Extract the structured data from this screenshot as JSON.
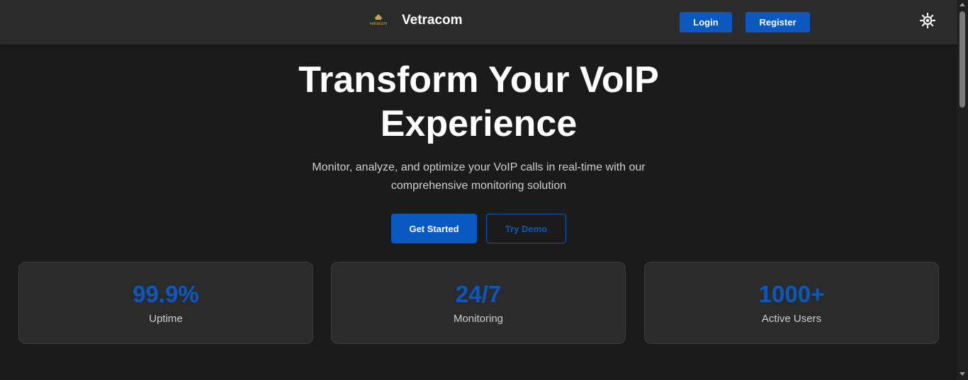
{
  "header": {
    "brand_name": "Vetracom",
    "logo_text": "vetracom",
    "login_label": "Login",
    "register_label": "Register",
    "theme_icon": "sun-icon"
  },
  "hero": {
    "title_line1": "Transform Your VoIP",
    "title_line2": "Experience",
    "subtitle_line1": "Monitor, analyze, and optimize your VoIP calls in real-time with our",
    "subtitle_line2": "comprehensive monitoring solution",
    "primary_cta": "Get Started",
    "secondary_cta": "Try Demo"
  },
  "stats": [
    {
      "value": "99.9%",
      "label": "Uptime"
    },
    {
      "value": "24/7",
      "label": "Monitoring"
    },
    {
      "value": "1000+",
      "label": "Active Users"
    }
  ],
  "colors": {
    "accent": "#0a58c2",
    "background": "#1b1b1b",
    "header_background": "#2b2b2b",
    "card_background": "#2b2b2b"
  }
}
